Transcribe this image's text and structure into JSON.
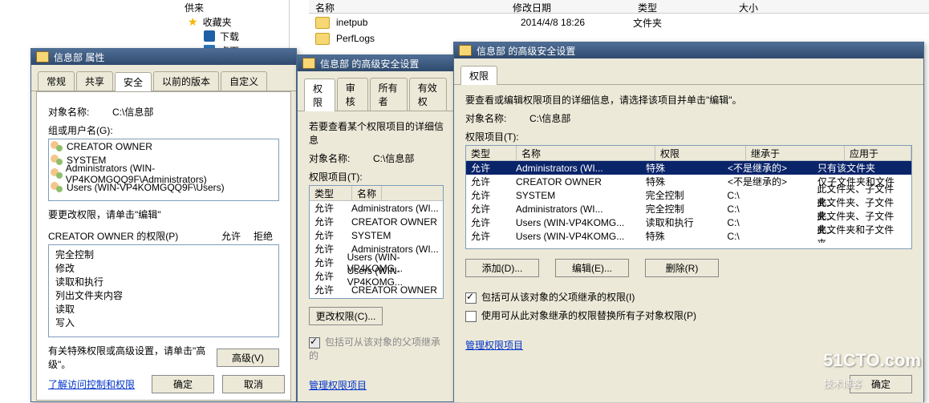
{
  "bg": {
    "supplier_label": "供来",
    "favorites": "收藏夹",
    "downloads": "下载",
    "desktop": "桌面",
    "explorer_headers": {
      "name": "名称",
      "date": "修改日期",
      "type": "类型",
      "size": "大小"
    },
    "rows": [
      {
        "name": "inetpub",
        "date": "2014/4/8 18:26",
        "type": "文件夹"
      },
      {
        "name": "PerfLogs",
        "date": "",
        "type": ""
      }
    ]
  },
  "win1": {
    "title": "信息部 属性",
    "tabs": [
      "常规",
      "共享",
      "安全",
      "以前的版本",
      "自定义"
    ],
    "active_tab": 2,
    "object_label": "对象名称:",
    "object_value": "C:\\信息部",
    "group_label": "组或用户名(G):",
    "groups": [
      "CREATOR OWNER",
      "SYSTEM",
      "Administrators (WIN-VP4KOMGQQ9F\\Administrators)",
      "Users (WIN-VP4KOMGQQ9F\\Users)"
    ],
    "change_hint": "要更改权限，请单击\"编辑\"",
    "perm_for_label": "CREATOR OWNER 的权限(P)",
    "allow": "允许",
    "deny": "拒绝",
    "perms": [
      "完全控制",
      "修改",
      "读取和执行",
      "列出文件夹内容",
      "读取",
      "写入"
    ],
    "adv_hint": "有关特殊权限或高级设置，请单击\"高级\"。",
    "adv_btn": "高级(V)",
    "learn_link": "了解访问控制和权限",
    "ok": "确定",
    "cancel": "取消"
  },
  "win2": {
    "title": "信息部 的高级安全设置",
    "tabs": [
      "权限",
      "审核",
      "所有者",
      "有效权"
    ],
    "active_tab": 0,
    "view_hint": "若要查看某个权限项目的详细信息",
    "object_label": "对象名称:",
    "object_value": "C:\\信息部",
    "items_label": "权限项目(T):",
    "col_type": "类型",
    "col_name": "名称",
    "rows": [
      {
        "type": "允许",
        "name": "Administrators (WI..."
      },
      {
        "type": "允许",
        "name": "CREATOR OWNER"
      },
      {
        "type": "允许",
        "name": "SYSTEM"
      },
      {
        "type": "允许",
        "name": "Administrators (WI..."
      },
      {
        "type": "允许",
        "name": "Users (WIN-VP4KOMG..."
      },
      {
        "type": "允许",
        "name": "Users (WIN-VP4KOMG..."
      },
      {
        "type": "允许",
        "name": "CREATOR OWNER"
      }
    ],
    "change_btn": "更改权限(C)...",
    "include_inherit": "包括可从该对象的父项继承的",
    "manage_link": "管理权限项目"
  },
  "win3": {
    "title": "信息部 的高级安全设置",
    "tabs": [
      "权限"
    ],
    "active_tab": 0,
    "view_hint": "要查看或编辑权限项目的详细信息，请选择该项目并单击\"编辑\"。",
    "object_label": "对象名称:",
    "object_value": "C:\\信息部",
    "items_label": "权限项目(T):",
    "cols": {
      "type": "类型",
      "name": "名称",
      "perm": "权限",
      "inherit": "继承于",
      "apply": "应用于"
    },
    "rows": [
      {
        "type": "允许",
        "name": "Administrators (WI...",
        "perm": "特殊",
        "inherit": "<不是继承的>",
        "apply": "只有该文件夹",
        "sel": true
      },
      {
        "type": "允许",
        "name": "CREATOR OWNER",
        "perm": "特殊",
        "inherit": "<不是继承的>",
        "apply": "仅子文件夹和文件"
      },
      {
        "type": "允许",
        "name": "SYSTEM",
        "perm": "完全控制",
        "inherit": "C:\\",
        "apply": "此文件夹、子文件夹..."
      },
      {
        "type": "允许",
        "name": "Administrators (WI...",
        "perm": "完全控制",
        "inherit": "C:\\",
        "apply": "此文件夹、子文件夹..."
      },
      {
        "type": "允许",
        "name": "Users (WIN-VP4KOMG...",
        "perm": "读取和执行",
        "inherit": "C:\\",
        "apply": "此文件夹、子文件夹..."
      },
      {
        "type": "允许",
        "name": "Users (WIN-VP4KOMG...",
        "perm": "特殊",
        "inherit": "C:\\",
        "apply": "此文件夹和子文件夹..."
      }
    ],
    "add_btn": "添加(D)...",
    "edit_btn": "编辑(E)...",
    "remove_btn": "删除(R)",
    "include_inherit": "包括可从该对象的父项继承的权限(I)",
    "replace_child": "使用可从此对象继承的权限替换所有子对象权限(P)",
    "manage_link": "管理权限项目",
    "ok": "确定"
  },
  "watermark": {
    "brand": "51CTO.com",
    "sub": "技术博客"
  }
}
